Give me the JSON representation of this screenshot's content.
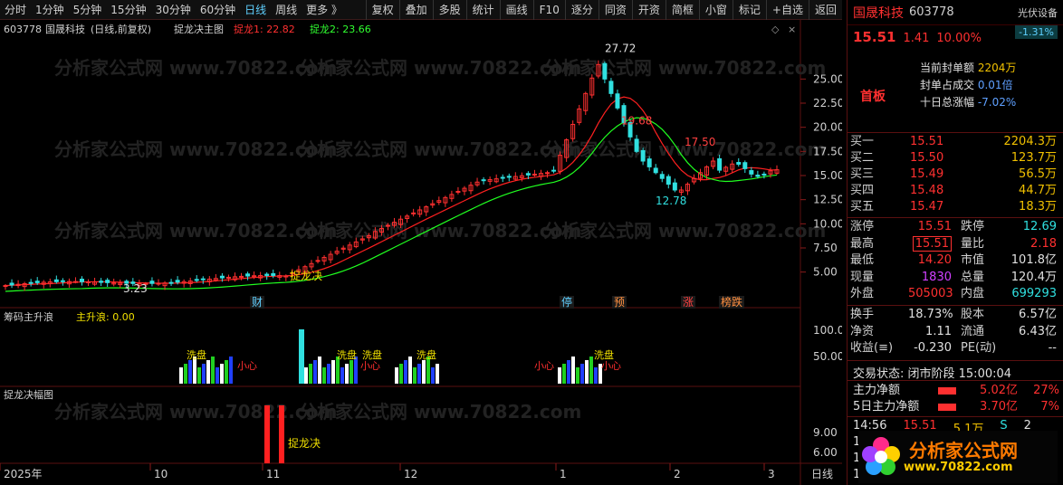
{
  "toolbar": {
    "periods": [
      "分时",
      "1分钟",
      "5分钟",
      "15分钟",
      "30分钟",
      "60分钟",
      "日线",
      "周线",
      "更多 》"
    ],
    "active_period": "日线",
    "buttons": [
      "复权",
      "叠加",
      "多股",
      "统计",
      "画线",
      "F10",
      "逐分",
      "同资",
      "开资",
      "简框",
      "小窗",
      "标记",
      "+自选",
      "返回"
    ]
  },
  "chart_header": {
    "code": "603778",
    "name": "国晟科技",
    "mode": "(日线,前复权)",
    "indicator": "捉龙决主图",
    "line1_label": "捉龙1: 22.82",
    "line2_label": "捉龙2: 23.66"
  },
  "panel2": {
    "title": "筹码主升浪",
    "value_label": "主升浪: 0.00"
  },
  "panel3": {
    "title": "捉龙决幅图"
  },
  "chart_data": {
    "type": "candlestick",
    "title": "国晟科技 (日线,前复权)",
    "y_ticks": [
      5.0,
      7.5,
      10.0,
      12.5,
      15.0,
      17.5,
      20.0,
      22.5,
      25.0
    ],
    "ylim": [
      3.0,
      28.5
    ],
    "x_labels": [
      "2025年",
      "10",
      "11",
      "12",
      "1",
      "2",
      "3"
    ],
    "period_label": "日线",
    "price_annotations": [
      "27.72",
      "19.68",
      "17.50",
      "12.78",
      "3.23"
    ],
    "event_markers": [
      "财",
      "停",
      "预",
      "涨",
      "榜跌"
    ],
    "signal_text": "捉龙决",
    "panel2_ticks": [
      "100.0",
      "50.00"
    ],
    "panel2_labels": [
      "洗盘",
      "洗盘",
      "洗盘",
      "洗盘",
      "洗盘",
      "小心",
      "小心",
      "小心",
      "小心"
    ],
    "panel3_ticks": [
      "9.00",
      "6.00"
    ]
  },
  "quote": {
    "name": "国晟科技",
    "code": "603778",
    "badge_label": "光伏设备",
    "badge_pct": "-1.31%",
    "price": "15.51",
    "change": "1.41",
    "change_pct": "10.00%",
    "seal_label": "当前封单额",
    "seal_value": "2204万",
    "seal_ratio_label": "封单占成交",
    "seal_ratio_value": "0.01倍",
    "ten_day_label": "十日总涨幅",
    "ten_day_value": "-7.02%",
    "first_board": "首板"
  },
  "order_book": [
    {
      "label": "买一",
      "price": "15.51",
      "vol": "2204.3万"
    },
    {
      "label": "买二",
      "price": "15.50",
      "vol": "123.7万"
    },
    {
      "label": "买三",
      "price": "15.49",
      "vol": "56.5万"
    },
    {
      "label": "买四",
      "price": "15.48",
      "vol": "44.7万"
    },
    {
      "label": "买五",
      "price": "15.47",
      "vol": "18.3万"
    }
  ],
  "stats1": [
    {
      "k1": "涨停",
      "v1": "15.51",
      "c1": "red",
      "k2": "跌停",
      "v2": "12.69",
      "c2": "green"
    },
    {
      "k1": "最高",
      "v1": "15.51",
      "c1": "red boxed",
      "k2": "量比",
      "v2": "2.18",
      "c2": "red"
    },
    {
      "k1": "最低",
      "v1": "14.20",
      "c1": "red",
      "k2": "市值",
      "v2": "101.8亿",
      "c2": "white"
    },
    {
      "k1": "现量",
      "v1": "1830",
      "c1": "purple",
      "k2": "总量",
      "v2": "120.4万",
      "c2": "white"
    },
    {
      "k1": "外盘",
      "v1": "505003",
      "c1": "red",
      "k2": "内盘",
      "v2": "699293",
      "c2": "green"
    }
  ],
  "stats2": [
    {
      "k1": "换手",
      "v1": "18.73%",
      "c1": "white",
      "k2": "股本",
      "v2": "6.57亿",
      "c2": "white"
    },
    {
      "k1": "净资",
      "v1": "1.11",
      "c1": "white",
      "k2": "流通",
      "v2": "6.43亿",
      "c2": "white"
    },
    {
      "k1": "收益(≡)",
      "v1": "-0.230",
      "c1": "white",
      "k2": "PE(动)",
      "v2": "--",
      "c2": "white"
    }
  ],
  "trade_state": "交易状态: 闭市阶段 15:00:04",
  "flows": [
    {
      "label": "主力净额",
      "value": "5.02亿",
      "pct": "27%"
    },
    {
      "label": "5日主力净额",
      "value": "3.70亿",
      "pct": "7%"
    }
  ],
  "tick": {
    "time": "14:56",
    "price": "15.51",
    "vol": "5.1万",
    "side": "S",
    "count": "2"
  },
  "tick_extra": [
    "14:",
    "14:",
    "15:"
  ],
  "logo": {
    "name": "分析家公式网",
    "url": "www.70822.com"
  },
  "watermark": "分析家公式网 www.70822.com",
  "colors": {
    "up": "#ff3030",
    "down": "#30e0e0",
    "ma1": "#ff2020",
    "ma2": "#20ff20",
    "bg": "#000000"
  }
}
